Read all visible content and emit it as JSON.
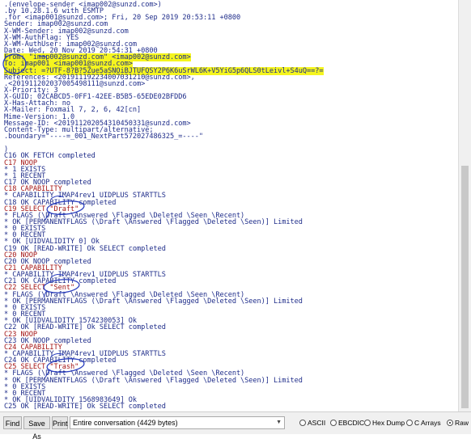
{
  "conversation_lines": [
    {
      "text": ".(envelope-sender <imap002@sunzd.com>)",
      "cls": "hdr"
    },
    {
      "text": ".by 10.28.1.6 with ESMTP",
      "cls": "hdr"
    },
    {
      "text": ".for <imap001@sunzd.com>; Fri, 20 Sep 2019 20:53:11 +0800",
      "cls": "hdr"
    },
    {
      "text": "Sender: imap002@sunzd.com",
      "cls": "hdr"
    },
    {
      "text": "X-WM-Sender: imap002@sunzd.com",
      "cls": "hdr"
    },
    {
      "text": "X-WM-AuthFlag: YES",
      "cls": "hdr"
    },
    {
      "text": "X-WM-AuthUser: imap002@sunzd.com",
      "cls": "hdr"
    },
    {
      "text": "Date: Wed, 20 Nov 2019 20:54:31 +0800",
      "cls": "hdr"
    },
    {
      "text": "From: \"imap002@sunzd.com\" <imap002@sunzd.com>",
      "cls": "hdr hl"
    },
    {
      "text": "To: imap001 <imap001@sunzd.com>",
      "cls": "hdr hl"
    },
    {
      "text": "Subject: =?UTF-8?B?5Zue5aSNOiBJTUFQSY2P6K6uSrWL6K+V5YiG5p6QLS0tLeivl+S4uQ==?=",
      "cls": "hdr hl"
    },
    {
      "text": "References: <201911192234007031210@sunzd.com>,",
      "cls": "hdr"
    },
    {
      "text": ".<201911202037005498111@sunzd.com>",
      "cls": "hdr"
    },
    {
      "text": "X-Priority: 3",
      "cls": "hdr"
    },
    {
      "text": "X-GUID: 02CABCD5-0FF1-42EE-B5B5-65EDE02BFDD6",
      "cls": "hdr"
    },
    {
      "text": "X-Has-Attach: no",
      "cls": "hdr"
    },
    {
      "text": "X-Mailer: Foxmail 7, 2, 6, 42[cn]",
      "cls": "hdr"
    },
    {
      "text": "Mime-Version: 1.0",
      "cls": "hdr"
    },
    {
      "text": "Message-ID: <201911202054310450331@sunzd.com>",
      "cls": "hdr"
    },
    {
      "text": "Content-Type: multipart/alternative;",
      "cls": "hdr"
    },
    {
      "text": ".boundary=\"----=_001_NextPart572027486325_=----\"",
      "cls": "hdr"
    },
    {
      "text": "",
      "cls": "hdr"
    },
    {
      "text": ")",
      "cls": "server"
    },
    {
      "text": "C16 OK FETCH completed",
      "cls": "server"
    },
    {
      "text": "C17 NOOP",
      "cls": "client"
    },
    {
      "text": "* 1 EXISTS",
      "cls": "server"
    },
    {
      "text": "* 1 RECENT",
      "cls": "server"
    },
    {
      "text": "C17 OK NOOP completed",
      "cls": "server"
    },
    {
      "text": "C18 CAPABILITY",
      "cls": "client"
    },
    {
      "text": "* CAPABILITY IMAP4rev1 UIDPLUS STARTTLS",
      "cls": "server"
    },
    {
      "text": "C18 OK CAPABILITY completed",
      "cls": "server"
    },
    {
      "text": "C19 SELECT \"Draft\"",
      "cls": "client"
    },
    {
      "text": "* FLAGS (\\Draft \\Answered \\Flagged \\Deleted \\Seen \\Recent)",
      "cls": "server"
    },
    {
      "text": "* OK [PERMANENTFLAGS (\\Draft \\Answered \\Flagged \\Deleted \\Seen)] Limited",
      "cls": "server"
    },
    {
      "text": "* 0 EXISTS",
      "cls": "server"
    },
    {
      "text": "* 0 RECENT",
      "cls": "server"
    },
    {
      "text": "* OK [UIDVALIDITY 0] Ok",
      "cls": "server"
    },
    {
      "text": "C19 OK [READ-WRITE] Ok SELECT completed",
      "cls": "server"
    },
    {
      "text": "C20 NOOP",
      "cls": "client"
    },
    {
      "text": "C20 OK NOOP completed",
      "cls": "server"
    },
    {
      "text": "C21 CAPABILITY",
      "cls": "client"
    },
    {
      "text": "* CAPABILITY IMAP4rev1 UIDPLUS STARTTLS",
      "cls": "server"
    },
    {
      "text": "C21 OK CAPABILITY completed",
      "cls": "server"
    },
    {
      "text": "C22 SELECT \"Sent\"",
      "cls": "client"
    },
    {
      "text": "* FLAGS (\\Draft \\Answered \\Flagged \\Deleted \\Seen \\Recent)",
      "cls": "server"
    },
    {
      "text": "* OK [PERMANENTFLAGS (\\Draft \\Answered \\Flagged \\Deleted \\Seen)] Limited",
      "cls": "server"
    },
    {
      "text": "* 0 EXISTS",
      "cls": "server"
    },
    {
      "text": "* 0 RECENT",
      "cls": "server"
    },
    {
      "text": "* OK [UIDVALIDITY 1574230053] Ok",
      "cls": "server"
    },
    {
      "text": "C22 OK [READ-WRITE] Ok SELECT completed",
      "cls": "server"
    },
    {
      "text": "C23 NOOP",
      "cls": "client"
    },
    {
      "text": "C23 OK NOOP completed",
      "cls": "server"
    },
    {
      "text": "C24 CAPABILITY",
      "cls": "client"
    },
    {
      "text": "* CAPABILITY IMAP4rev1 UIDPLUS STARTTLS",
      "cls": "server"
    },
    {
      "text": "C24 OK CAPABILITY completed",
      "cls": "server"
    },
    {
      "text": "C25 SELECT \"Trash\"",
      "cls": "client"
    },
    {
      "text": "* FLAGS (\\Draft \\Answered \\Flagged \\Deleted \\Seen \\Recent)",
      "cls": "server"
    },
    {
      "text": "* OK [PERMANENTFLAGS (\\Draft \\Answered \\Flagged \\Deleted \\Seen)] Limited",
      "cls": "server"
    },
    {
      "text": "* 0 EXISTS",
      "cls": "server"
    },
    {
      "text": "* 0 RECENT",
      "cls": "server"
    },
    {
      "text": "* OK [UIDVALIDITY 1568983649] Ok",
      "cls": "server"
    },
    {
      "text": "C25 OK [READ-WRITE] Ok SELECT completed",
      "cls": "server"
    }
  ],
  "toolbar": {
    "find_label": "Find",
    "save_as_label": "Save As",
    "print_label": "Print",
    "conversation_select": "Entire conversation (4429 bytes)",
    "radio_ascii": "ASCII",
    "radio_ebcdic": "EBCDIC",
    "radio_hexdump": "Hex Dump",
    "radio_carrays": "C Arrays",
    "radio_raw": "Raw",
    "selected": "Raw"
  },
  "colors": {
    "server_text": "#1f2d8a",
    "client_text": "#a31515",
    "highlight": "#f5f51e",
    "annotation_ink": "#2b3fbf"
  }
}
